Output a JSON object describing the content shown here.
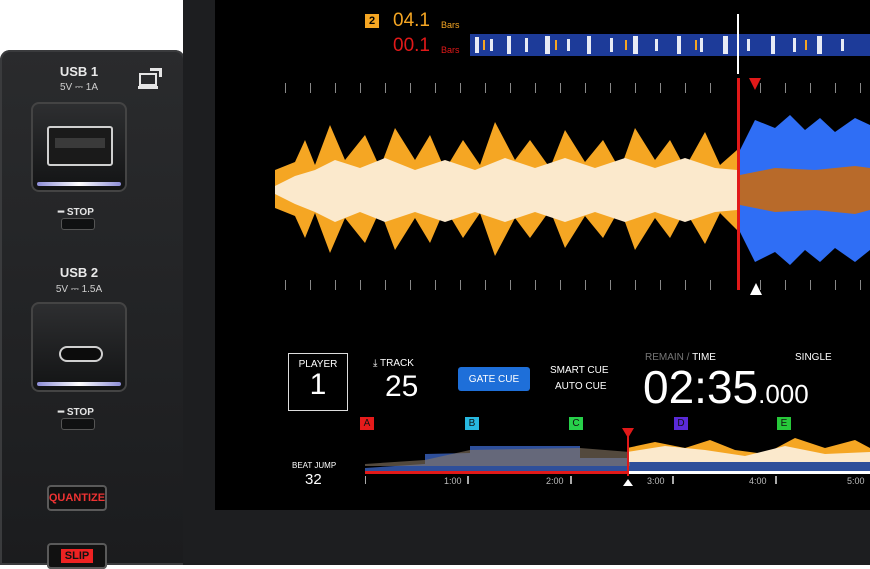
{
  "hardware": {
    "usb1": {
      "title": "USB 1",
      "spec": "5V ⎓ 1A",
      "stop_label": "STOP"
    },
    "usb2": {
      "title": "USB 2",
      "spec": "5V ⎓ 1.5A",
      "stop_label": "STOP"
    },
    "buttons": {
      "quantize": "QUANTIZE",
      "slip": "SLIP"
    },
    "icons": [
      "laptop-icon"
    ]
  },
  "screen": {
    "loop": {
      "badge": "2",
      "bars_top_value": "04.1",
      "bars_top_unit": "Bars",
      "bars_bottom_value": "00.1",
      "bars_bottom_unit": "Bars"
    },
    "player": {
      "label": "PLAYER",
      "number": "1"
    },
    "track": {
      "label": "TRACK",
      "number": "25"
    },
    "gate_cue": "GATE CUE",
    "smart_cue": "SMART CUE",
    "auto_cue": "AUTO CUE",
    "remain": "REMAIN",
    "time_label": "TIME",
    "single": "SINGLE",
    "time_main": "02:35",
    "time_ms": ".000",
    "beat_jump": {
      "label": "BEAT JUMP",
      "value": "32"
    },
    "hotcues": [
      "A",
      "B",
      "C",
      "D",
      "E"
    ],
    "timeline": [
      "1:00",
      "2:00",
      "3:00",
      "4:00",
      "5:00"
    ]
  },
  "colors": {
    "orange": "#f5a623",
    "blue": "#2f6ef5",
    "red": "#e11919",
    "gate_cue_bg": "#1e6fd9",
    "hotcue_a": "#e51b1b",
    "hotcue_b": "#27b8e0",
    "hotcue_c": "#27d04a",
    "hotcue_d": "#5a2ad8",
    "hotcue_e": "#27c83a"
  }
}
